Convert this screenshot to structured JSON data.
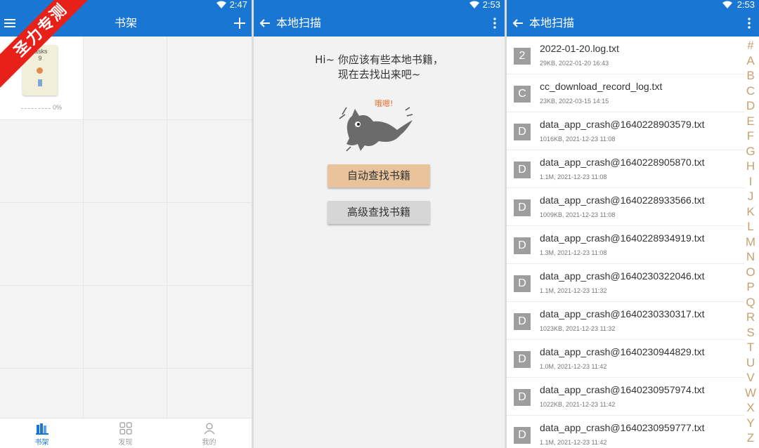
{
  "watermark": "圣力专测",
  "bookshelf": {
    "status_time": "2:47",
    "title": "书架",
    "book": {
      "cover_line1": "tasks",
      "cover_line2": "9",
      "progress": "0%"
    },
    "tabs": [
      {
        "label": "书架"
      },
      {
        "label": "发现"
      },
      {
        "label": "我的"
      }
    ]
  },
  "scan_empty": {
    "status_time": "2:53",
    "title": "本地扫描",
    "message_line1": "Hi~ 你应该有些本地书籍，",
    "message_line2": "现在去找出来吧~",
    "cat_bubble": "哦嗯!",
    "auto_button": "自动查找书籍",
    "advanced_button": "高级查找书籍"
  },
  "scan_list": {
    "status_time": "2:53",
    "title": "本地扫描",
    "files": [
      {
        "letter": "2",
        "name": "2022-01-20.log.txt",
        "meta": "29KB, 2022-01-20 16:43"
      },
      {
        "letter": "C",
        "name": "cc_download_record_log.txt",
        "meta": "23KB, 2022-03-15 14:15"
      },
      {
        "letter": "D",
        "name": "data_app_crash@1640228903579.txt",
        "meta": "1016KB, 2021-12-23 11:08"
      },
      {
        "letter": "D",
        "name": "data_app_crash@1640228905870.txt",
        "meta": "1.1M, 2021-12-23 11:08"
      },
      {
        "letter": "D",
        "name": "data_app_crash@1640228933566.txt",
        "meta": "1009KB, 2021-12-23 11:08"
      },
      {
        "letter": "D",
        "name": "data_app_crash@1640228934919.txt",
        "meta": "1.3M, 2021-12-23 11:08"
      },
      {
        "letter": "D",
        "name": "data_app_crash@1640230322046.txt",
        "meta": "1.1M, 2021-12-23 11:32"
      },
      {
        "letter": "D",
        "name": "data_app_crash@1640230330317.txt",
        "meta": "1023KB, 2021-12-23 11:32"
      },
      {
        "letter": "D",
        "name": "data_app_crash@1640230944829.txt",
        "meta": "1.0M, 2021-12-23 11:42"
      },
      {
        "letter": "D",
        "name": "data_app_crash@1640230957974.txt",
        "meta": "1022KB, 2021-12-23 11:42"
      },
      {
        "letter": "D",
        "name": "data_app_crash@1640230959777.txt",
        "meta": "1.1M, 2021-12-23 11:42"
      }
    ],
    "alphabet": [
      "#",
      "A",
      "B",
      "C",
      "D",
      "E",
      "F",
      "G",
      "H",
      "I",
      "J",
      "K",
      "L",
      "M",
      "N",
      "O",
      "P",
      "Q",
      "R",
      "S",
      "T",
      "U",
      "V",
      "W",
      "X",
      "Y",
      "Z"
    ]
  },
  "colors": {
    "appbar": "#1976d2",
    "auto_button": "#e8c39c",
    "advanced_button": "#d6d6d6",
    "alpha_index": "#c8a070",
    "watermark": "#e8201a"
  }
}
